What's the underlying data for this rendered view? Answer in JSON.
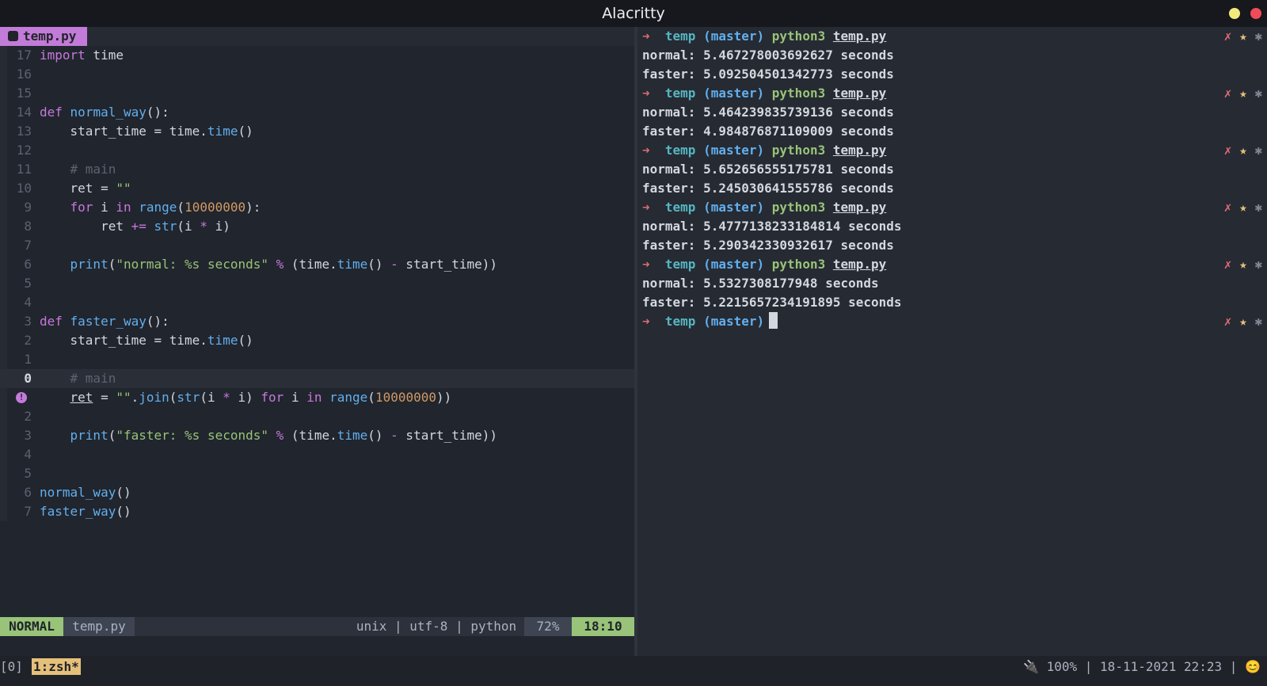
{
  "window": {
    "title": "Alacritty"
  },
  "editor": {
    "tab": {
      "filename": "temp.py",
      "icon": "python-icon"
    },
    "status": {
      "mode": "NORMAL",
      "file": "temp.py",
      "info": "unix | utf-8 | python",
      "percent": "72%",
      "position": "18:10"
    },
    "line_numbers": [
      "17",
      "16",
      "15",
      "14",
      "13",
      "12",
      "11",
      "10",
      "9",
      "8",
      "7",
      "6",
      "5",
      "4",
      "3",
      "2",
      "1",
      "0",
      "",
      "2",
      "3",
      "4",
      "5",
      "6",
      "7"
    ]
  },
  "terminal": {
    "runs": [
      {
        "normal": "normal: 5.467278003692627 seconds",
        "faster": "faster: 5.092504501342773 seconds"
      },
      {
        "normal": "normal: 5.464239835739136 seconds",
        "faster": "faster: 4.984876871109009 seconds"
      },
      {
        "normal": "normal: 5.652656555175781 seconds",
        "faster": "faster: 5.245030641555786 seconds"
      },
      {
        "normal": "normal: 5.4777138233184814 seconds",
        "faster": "faster: 5.290342330932617 seconds"
      },
      {
        "normal": "normal: 5.5327308177948 seconds",
        "faster": "faster: 5.2215657234191895 seconds"
      }
    ],
    "prompt": {
      "arrow": "➜",
      "dir": "temp",
      "branch": "(master)",
      "cmd": "python3",
      "arg": "temp.py"
    },
    "rprompt": {
      "x": "✗",
      "star": "★",
      "gear": "✱"
    }
  },
  "tmux": {
    "session": "[0]",
    "window": "1:zsh*",
    "status": "🔌 100% | 18-11-2021 22:23 | 😊"
  }
}
